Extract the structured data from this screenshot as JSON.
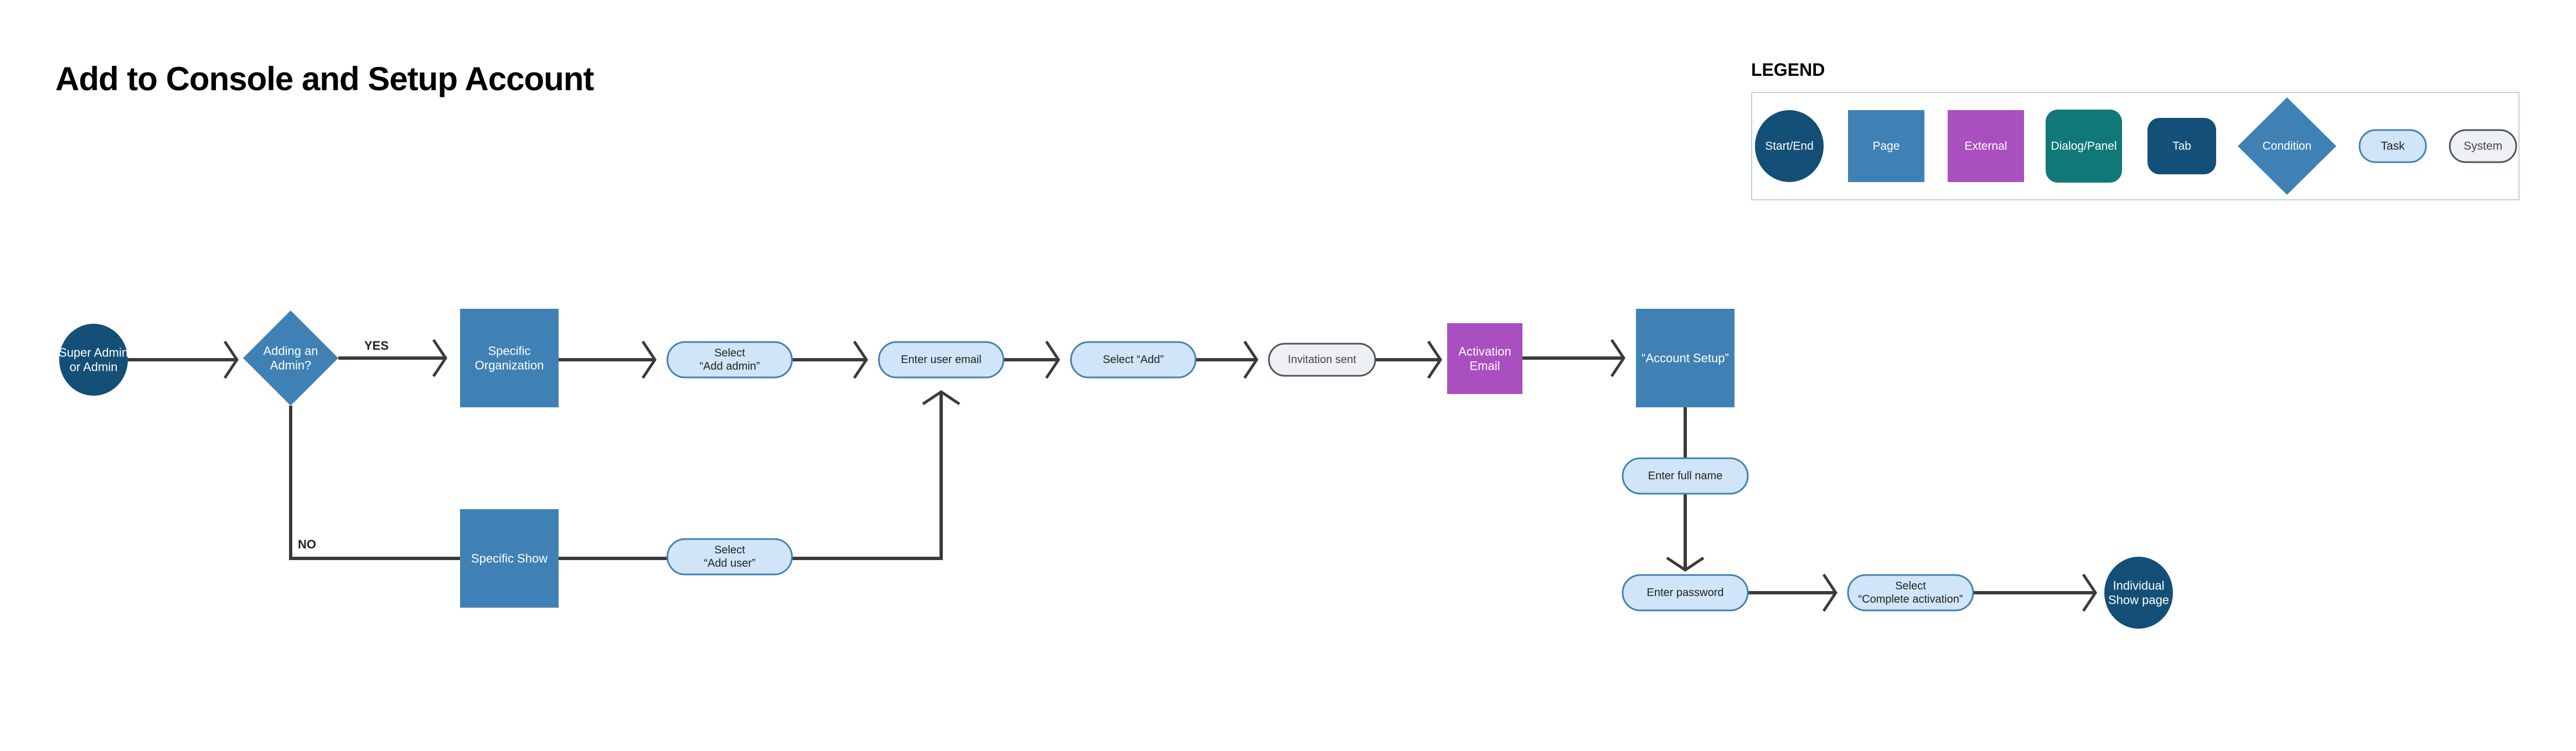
{
  "title": "Add to Console and Setup Account",
  "legend": {
    "title": "LEGEND",
    "items": [
      {
        "label": "Start/End",
        "shape": "ellipse",
        "fill": "#134f76",
        "text_color": "#ffffff"
      },
      {
        "label": "Page",
        "shape": "rect",
        "fill": "#4081b5",
        "text_color": "#ffffff"
      },
      {
        "label": "External",
        "shape": "rect",
        "fill": "#a94fc0",
        "text_color": "#ffffff"
      },
      {
        "label": "Dialog/Panel",
        "shape": "rounded-rect",
        "fill": "#107877",
        "text_color": "#ffffff"
      },
      {
        "label": "Tab",
        "shape": "rounded-rect",
        "fill": "#134f76",
        "text_color": "#ffffff"
      },
      {
        "label": "Condition",
        "shape": "diamond",
        "fill": "#4081b5",
        "text_color": "#ffffff"
      },
      {
        "label": "Task",
        "shape": "pill",
        "fill": "#d0e5f7",
        "stroke": "#4081b5",
        "text_color": "#222222"
      },
      {
        "label": "System",
        "shape": "pill",
        "fill": "#eef0f3",
        "stroke": "#4b5560",
        "text_color": "#444444"
      }
    ]
  },
  "flow": {
    "nodes": {
      "start": {
        "type": "Start/End",
        "lines": [
          "Super Admin",
          "or Admin"
        ]
      },
      "condition": {
        "type": "Condition",
        "lines": [
          "Adding an",
          "Admin?"
        ]
      },
      "org": {
        "type": "Page",
        "lines": [
          "Specific",
          "Organization"
        ]
      },
      "add_admin": {
        "type": "Task",
        "lines": [
          "Select",
          "“Add admin”"
        ]
      },
      "email": {
        "type": "Task",
        "lines": [
          "Enter user email"
        ]
      },
      "add": {
        "type": "Task",
        "lines": [
          "Select “Add”"
        ]
      },
      "invite": {
        "type": "System",
        "lines": [
          "Invitation sent"
        ]
      },
      "activation": {
        "type": "External",
        "lines": [
          "Activation",
          "Email"
        ]
      },
      "account_setup": {
        "type": "Page",
        "lines": [
          "“Account Setup”"
        ]
      },
      "full_name": {
        "type": "Task",
        "lines": [
          "Enter full name"
        ]
      },
      "password": {
        "type": "Task",
        "lines": [
          "Enter password"
        ]
      },
      "complete": {
        "type": "Task",
        "lines": [
          "Select",
          "“Complete activation”"
        ]
      },
      "end": {
        "type": "Start/End",
        "lines": [
          "Individual",
          "Show page"
        ]
      },
      "show": {
        "type": "Page",
        "lines": [
          "Specific Show"
        ]
      },
      "add_user": {
        "type": "Task",
        "lines": [
          "Select",
          "“Add user”"
        ]
      }
    },
    "edge_labels": {
      "yes": "YES",
      "no": "NO"
    },
    "edges": [
      [
        "start",
        "condition"
      ],
      [
        "condition",
        "org",
        "YES"
      ],
      [
        "org",
        "add_admin"
      ],
      [
        "add_admin",
        "email"
      ],
      [
        "email",
        "add"
      ],
      [
        "add",
        "invite"
      ],
      [
        "invite",
        "activation"
      ],
      [
        "activation",
        "account_setup"
      ],
      [
        "account_setup",
        "full_name"
      ],
      [
        "full_name",
        "password"
      ],
      [
        "password",
        "complete"
      ],
      [
        "complete",
        "end"
      ],
      [
        "condition",
        "show",
        "NO"
      ],
      [
        "show",
        "add_user"
      ],
      [
        "add_user",
        "email"
      ]
    ]
  }
}
